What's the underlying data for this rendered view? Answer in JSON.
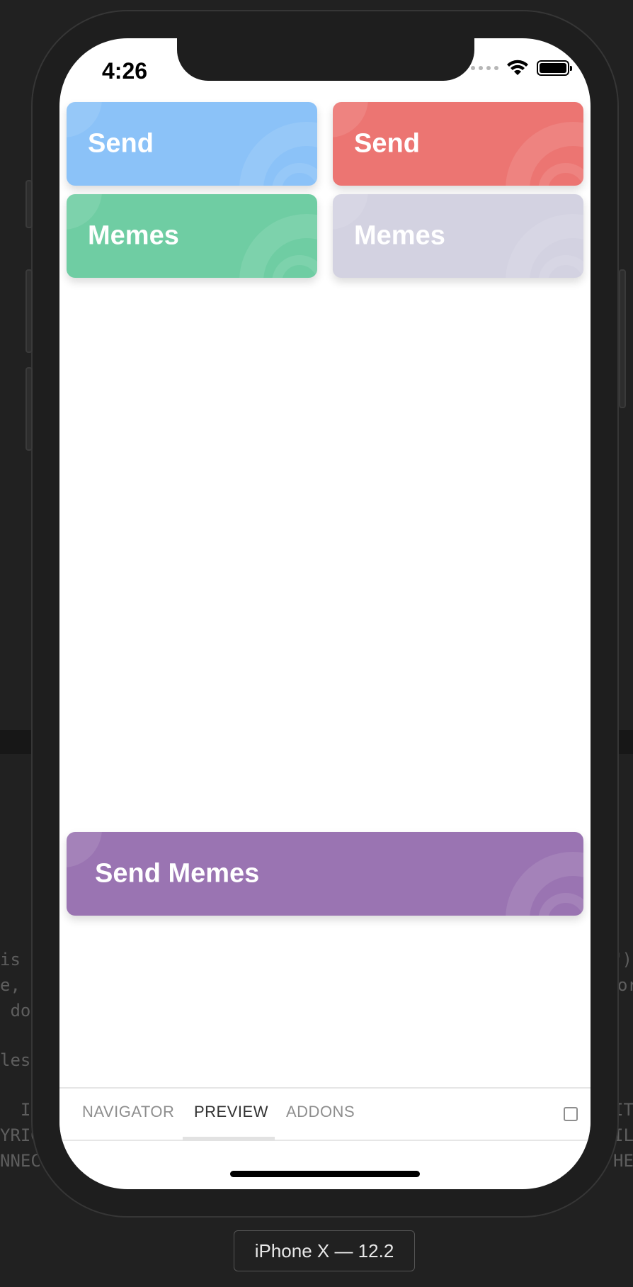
{
  "status_bar": {
    "time": "4:26"
  },
  "cards": [
    {
      "label": "Send",
      "color": "#8bc2f8"
    },
    {
      "label": "Send",
      "color": "#ec7572"
    },
    {
      "label": "Memes",
      "color": "#6fcda3"
    },
    {
      "label": "Memes",
      "color": "#d3d2e1"
    }
  ],
  "wide_card": {
    "label": "Send Memes",
    "color": "#9a74b2"
  },
  "tabs": [
    "NAVIGATOR",
    "PREVIEW",
    "ADDONS"
  ],
  "active_tab": "PREVIEW",
  "device_label": "iPhone X — 12.2",
  "bg_code": [
    "is s",
    "e, c",
    " do",
    "les",
    "  IN",
    "YRIG",
    "NNECT",
    "\")",
    "or",
    "IT",
    "IL",
    "HE"
  ]
}
